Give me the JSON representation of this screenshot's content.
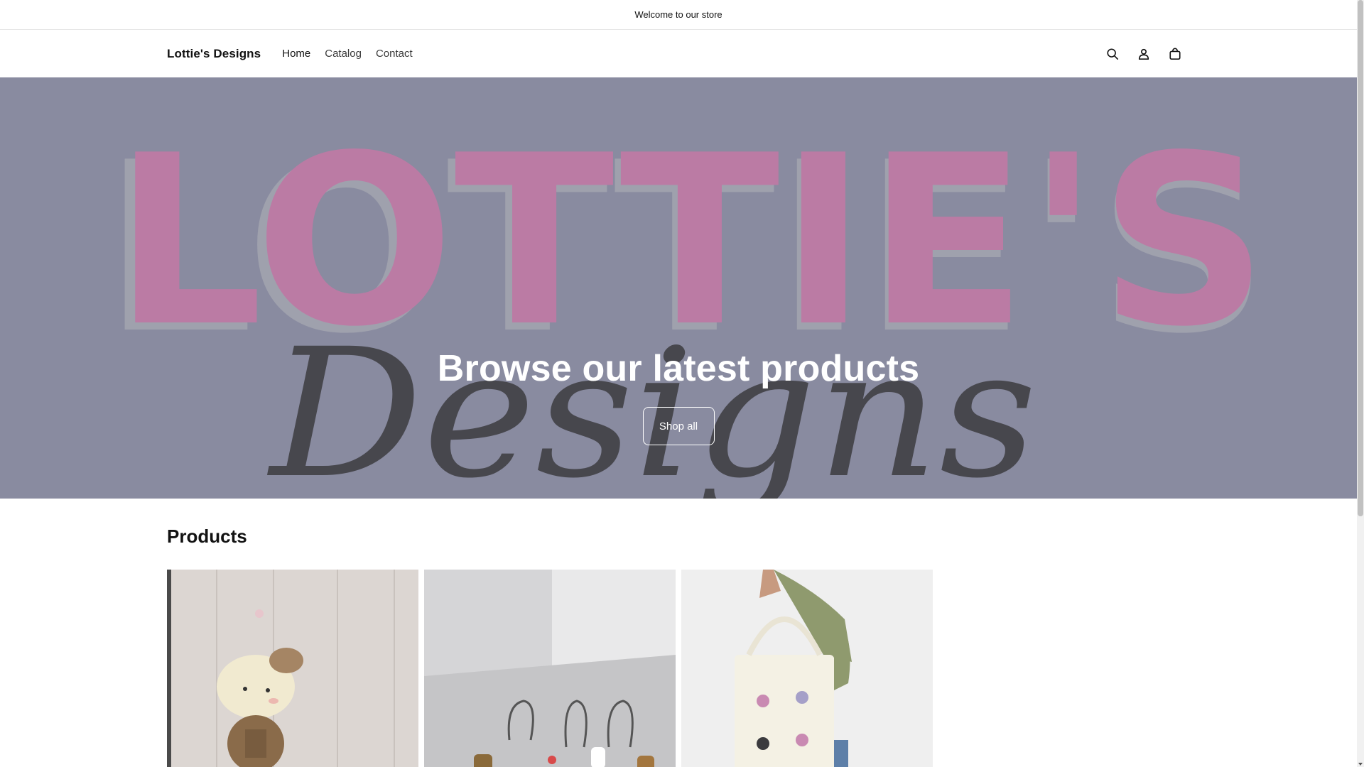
{
  "announcement": {
    "text": "Welcome to our store"
  },
  "header": {
    "logo": "Lottie's Designs",
    "nav": [
      {
        "label": "Home"
      },
      {
        "label": "Catalog"
      },
      {
        "label": "Contact"
      }
    ],
    "icons": [
      "search-icon",
      "account-icon",
      "cart-icon"
    ]
  },
  "hero": {
    "banner_text_top": "LOTTIE'S",
    "banner_text_bottom": "Designs",
    "title": "Browse our latest products",
    "button_label": "Shop all"
  },
  "products": {
    "heading": "Products"
  },
  "colors": {
    "hero_overlay": "#8c8ea3",
    "banner_pink": "#c97aa8",
    "banner_script": "#3b3b3e"
  }
}
